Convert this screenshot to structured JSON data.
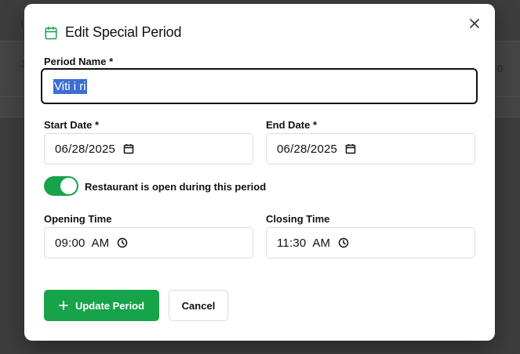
{
  "background": {
    "edge_text_1": "I",
    "edge_text_2": "J",
    "edge_text_3": "0"
  },
  "modal": {
    "title": "Edit Special Period",
    "title_icon": "calendar-icon",
    "close_icon": "close-icon",
    "period_name": {
      "label": "Period Name *",
      "value": "Viti i ri"
    },
    "start_date": {
      "label": "Start Date *",
      "value": "06/28/2025",
      "icon": "calendar-icon"
    },
    "end_date": {
      "label": "End Date *",
      "value": "06/28/2025",
      "icon": "calendar-icon"
    },
    "open_toggle": {
      "label": "Restaurant is open during this period",
      "on": true
    },
    "opening_time": {
      "label": "Opening Time",
      "value": "09:00  AM",
      "icon": "clock-icon"
    },
    "closing_time": {
      "label": "Closing Time",
      "value": "11:30  AM",
      "icon": "clock-icon"
    },
    "update_button": "Update Period",
    "cancel_button": "Cancel"
  },
  "colors": {
    "accent": "#16a34a",
    "selection": "#3c6fd1"
  }
}
